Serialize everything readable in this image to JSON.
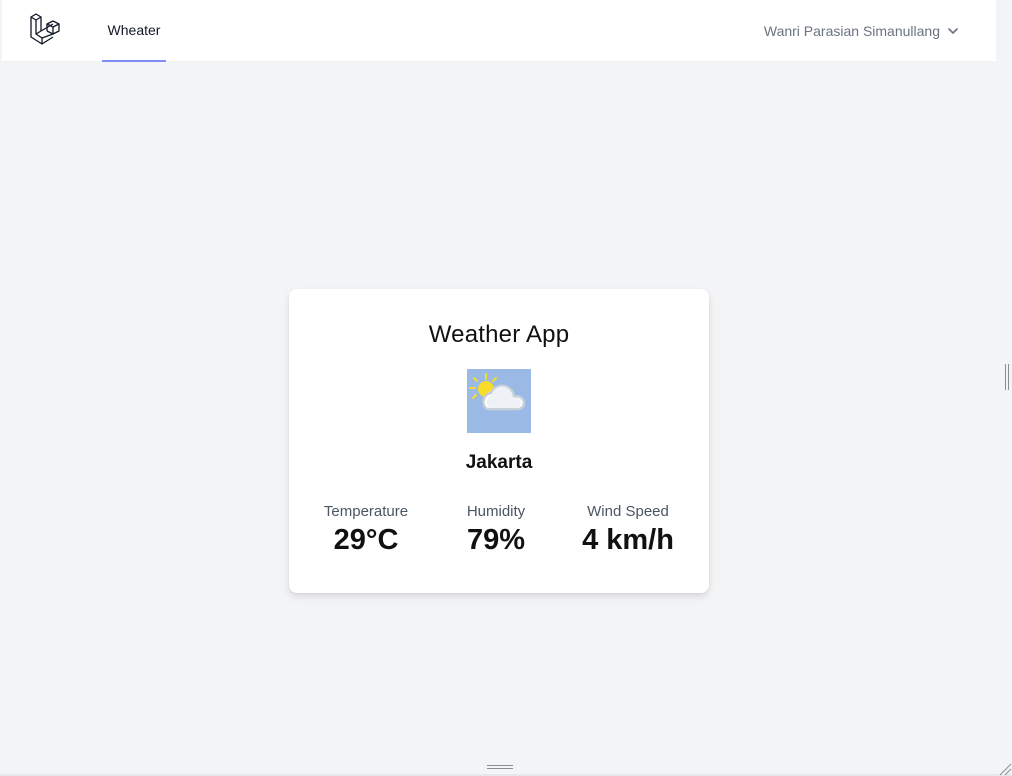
{
  "navbar": {
    "logo_icon": "laravel-logo-icon",
    "links": [
      {
        "label": "Wheater",
        "active": true
      }
    ],
    "user": {
      "name": "Wanri Parasian Simanullang",
      "dropdown_icon": "chevron-down-icon"
    }
  },
  "card": {
    "title": "Weather App",
    "icon": "partly-cloudy-icon",
    "city": "Jakarta",
    "stats": {
      "temperature": {
        "label": "Temperature",
        "value": "29°C"
      },
      "humidity": {
        "label": "Humidity",
        "value": "79%"
      },
      "wind_speed": {
        "label": "Wind Speed",
        "value": "4 km/h"
      }
    }
  },
  "colors": {
    "page_bg": "#f3f4f6",
    "active_tab_underline": "#818cf8",
    "icon_bg": "#9ab9e4",
    "sun": "#f7dc2a"
  }
}
